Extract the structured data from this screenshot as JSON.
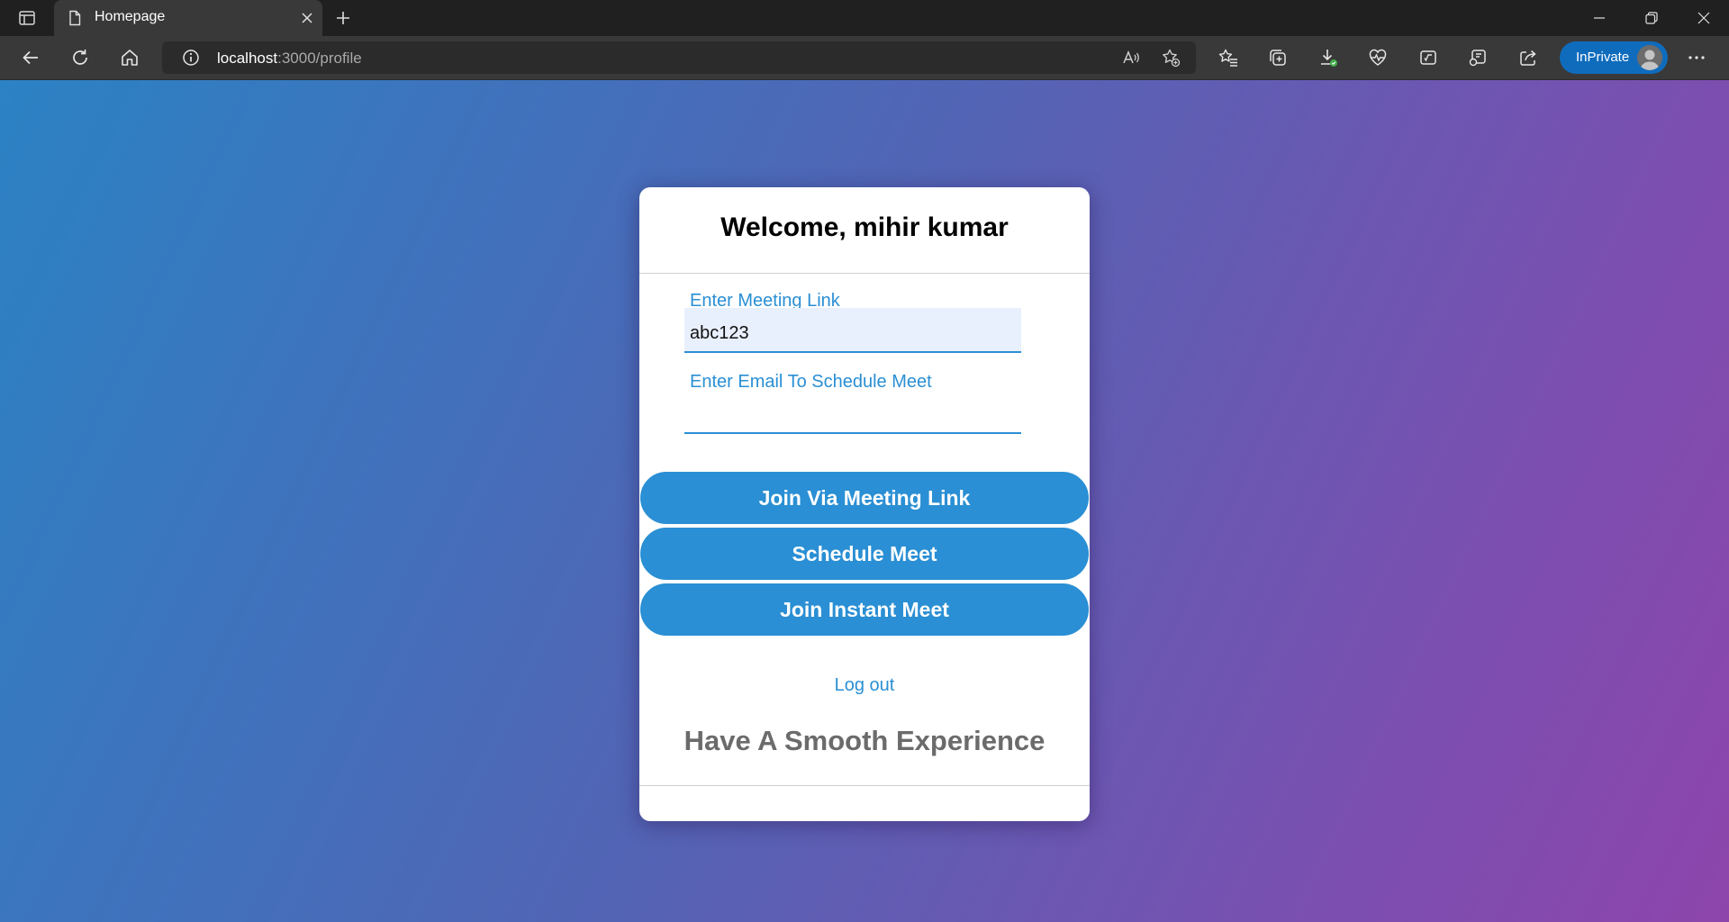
{
  "browser": {
    "tab": {
      "title": "Homepage",
      "icon": "document-icon"
    },
    "address": {
      "host": "localhost",
      "path": ":3000/profile"
    },
    "inprivate_label": "InPrivate",
    "colors": {
      "chrome": "#202020",
      "toolbar": "#393939",
      "inprivate": "#0f6cbd"
    }
  },
  "card": {
    "welcome": "Welcome, mihir kumar",
    "meeting_link_label": "Enter Meeting Link",
    "meeting_link_value": "abc123",
    "email_label": "Enter Email To Schedule Meet",
    "email_value": "",
    "buttons": {
      "join_link": "Join Via Meeting Link",
      "schedule": "Schedule Meet",
      "instant": "Join Instant Meet"
    },
    "logout": "Log out",
    "tagline": "Have A Smooth Experience"
  },
  "colors": {
    "accent": "#2a8fd4",
    "gradient_start": "#2b82c4",
    "gradient_end": "#8d45ac"
  }
}
